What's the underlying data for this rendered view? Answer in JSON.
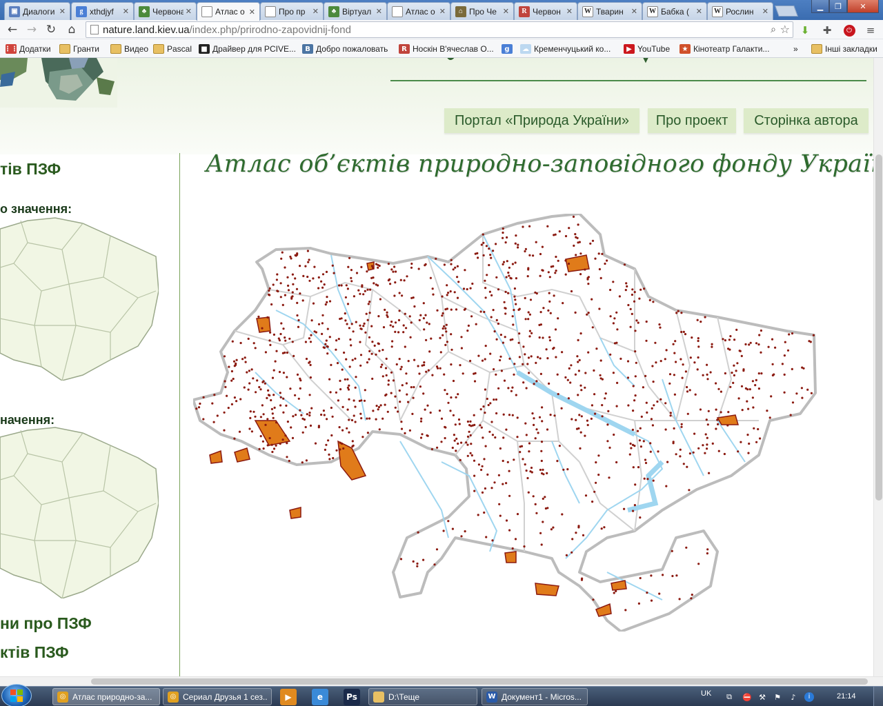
{
  "browser": {
    "tabs": [
      {
        "label": "Диалоги",
        "favicon": "dialog-favicon-icon",
        "color": "#5b7fbf",
        "glyph": "▣"
      },
      {
        "label": "xthdjyf",
        "favicon": "google-favicon-icon",
        "color": "#4a7fd6",
        "glyph": "g"
      },
      {
        "label": "Червона",
        "favicon": "leaf-favicon-icon",
        "color": "#4c8a3c",
        "glyph": "♣"
      },
      {
        "label": "Атлас о",
        "favicon": "page-favicon-icon",
        "color": "#ffffff",
        "glyph": ""
      },
      {
        "label": "Про пр",
        "favicon": "page-favicon-icon",
        "color": "#ffffff",
        "glyph": ""
      },
      {
        "label": "Віртуал",
        "favicon": "leaf-favicon-icon",
        "color": "#4c8a3c",
        "glyph": "♣"
      },
      {
        "label": "Атлас о",
        "favicon": "page-favicon-icon",
        "color": "#ffffff",
        "glyph": ""
      },
      {
        "label": "Про Че",
        "favicon": "museum-favicon-icon",
        "color": "#7a6a3a",
        "glyph": "⌂"
      },
      {
        "label": "Червон",
        "favicon": "r-favicon-icon",
        "color": "#c0443c",
        "glyph": "R"
      },
      {
        "label": "Тварин",
        "favicon": "wikipedia-favicon-icon",
        "color": "#ffffff",
        "glyph": "W"
      },
      {
        "label": "Бабка (",
        "favicon": "wikipedia-favicon-icon",
        "color": "#ffffff",
        "glyph": "W"
      },
      {
        "label": "Рослин",
        "favicon": "wikipedia-favicon-icon",
        "color": "#ffffff",
        "glyph": "W"
      }
    ],
    "active_tab": 3,
    "url_host": "nature.land.kiev.ua",
    "url_path": "/index.php/prirodno-zapovidnij-fond",
    "bookmarks": [
      {
        "label": "Додатки",
        "icon": "apps-grid-icon",
        "color": "#d0443c",
        "glyph": "⋮⋮"
      },
      {
        "label": "Гранти",
        "icon": "folder-icon",
        "color": "#e8c063",
        "glyph": ""
      },
      {
        "label": "Видео",
        "icon": "folder-icon",
        "color": "#e8c063",
        "glyph": ""
      },
      {
        "label": "Pascal",
        "icon": "folder-icon",
        "color": "#e8c063",
        "glyph": ""
      },
      {
        "label": "Драйвер для PCIVE...",
        "icon": "monitor-icon",
        "color": "#222222",
        "glyph": "■"
      },
      {
        "label": "Добро пожаловать",
        "icon": "vk-icon",
        "color": "#4c75a3",
        "glyph": "B"
      },
      {
        "label": "Носкін В'ячеслав О...",
        "icon": "r-bookmark-icon",
        "color": "#c0443c",
        "glyph": "R"
      },
      {
        "label": "",
        "icon": "google-bookmark-icon",
        "color": "#4a7fd6",
        "glyph": "g"
      },
      {
        "label": "Кременчуцький ко...",
        "icon": "cloud-icon",
        "color": "#bcd8f0",
        "glyph": "☁"
      },
      {
        "label": "YouTube",
        "icon": "youtube-icon",
        "color": "#cc181e",
        "glyph": "▶"
      },
      {
        "label": "Кінотеатр Галакти...",
        "icon": "star-badge-icon",
        "color": "#d0502a",
        "glyph": "★"
      },
      {
        "label": "»",
        "icon": "",
        "color": "",
        "glyph": ""
      },
      {
        "label": "Інші закладки",
        "icon": "folder-icon",
        "color": "#e8c063",
        "glyph": ""
      }
    ]
  },
  "site": {
    "nav": [
      "Портал «Природа України»",
      "Про проект",
      "Сторінка автора"
    ],
    "title": "Атлас об’єктів природно-заповідного фонду України",
    "sidebar": {
      "heading_top": "тів ПЗФ",
      "heading_national": "о значення:",
      "heading_local": "начення:",
      "link_about": "ни про ПЗФ",
      "link_objects": "ктів ПЗФ"
    },
    "colors": {
      "nav_bg": "#ddebc9",
      "nav_text": "#2a5a2a",
      "title": "#2f6b2f",
      "reserve_dot": "#8b1a10",
      "reserve_area": "#e07b1a",
      "river": "#9fd6f0",
      "border": "#b8b8b8"
    }
  },
  "taskbar": {
    "windows": [
      {
        "label": "Атлас природно-за...",
        "icon": "chrome-icon",
        "color": "#e0a020",
        "glyph": "◎",
        "active": true
      },
      {
        "label": "Сериал Друзья 1 сез...",
        "icon": "chrome-icon",
        "color": "#e0a020",
        "glyph": "◎",
        "active": false
      },
      {
        "label": "D:\\Теще",
        "icon": "folder-icon",
        "color": "#e8c063",
        "glyph": "",
        "active": false
      },
      {
        "label": "Документ1 - Micros...",
        "icon": "word-icon",
        "color": "#2a5aa8",
        "glyph": "W",
        "active": false
      }
    ],
    "quick_launch": [
      {
        "icon": "media-player-icon",
        "color": "#e08a20",
        "glyph": "▶"
      },
      {
        "icon": "ie-icon",
        "color": "#3a8ad8",
        "glyph": "e"
      },
      {
        "icon": "photoshop-icon",
        "color": "#1a2a4a",
        "glyph": "Ps"
      }
    ],
    "lang": "UK",
    "time": "21:14"
  }
}
